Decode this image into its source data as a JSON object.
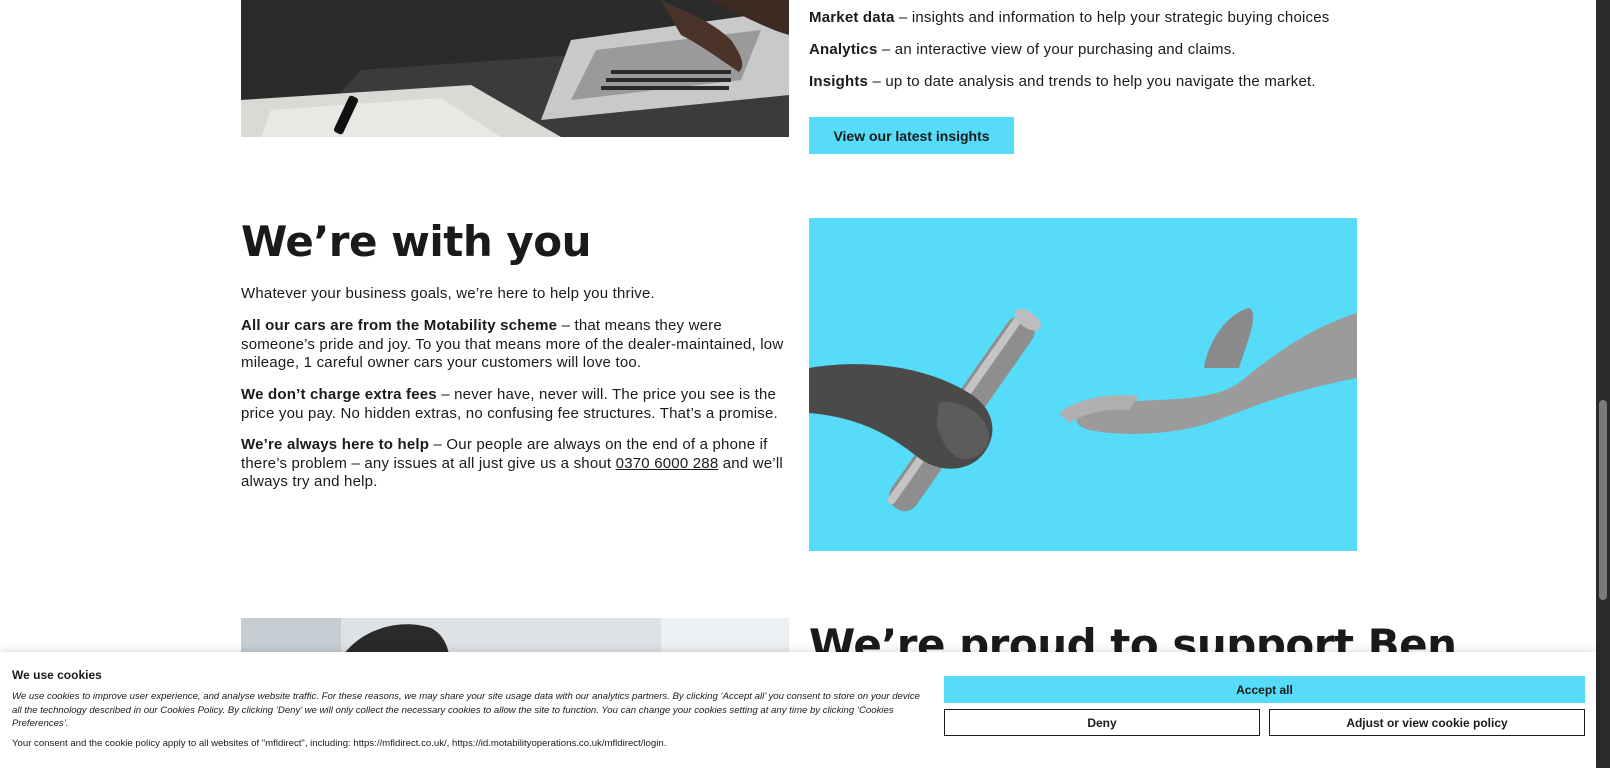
{
  "insights": {
    "items": [
      {
        "bold": "Market data",
        "text": " – insights and information to help your strategic buying choices"
      },
      {
        "bold": "Analytics",
        "text": " – an interactive view of your purchasing and claims."
      },
      {
        "bold": "Insights",
        "text": " – up to date analysis and trends to help you navigate the market."
      }
    ],
    "button_label": "View our latest insights"
  },
  "with_you": {
    "heading": "We’re with you",
    "intro": "Whatever your business goals, we’re here to help you thrive.",
    "p1_bold": "All our cars are from the Motability scheme",
    "p1_text": " – that means they were someone’s pride and joy. To you that means more of the dealer-maintained, low mileage, 1 careful owner cars your customers will love too.",
    "p2_bold": "We don’t charge extra fees",
    "p2_text": " – never have, never will. The price you see is the price you pay. No hidden extras, no confusing fee structures. That’s a promise.",
    "p3_bold": "We’re always here to help",
    "p3_text": " – Our people are always on the end of a phone if there’s problem – any issues at all just give us a shout",
    "p3_phone": "0370 6000 288",
    "p3_after": " and we’ll always try and help."
  },
  "support": {
    "heading": "We’re proud to support Ben"
  },
  "cookie": {
    "title": "We use cookies",
    "text": "We use cookies to improve user experience, and analyse website traffic. For these reasons, we may share your site usage data with our analytics partners. By clicking ‘Accept all’ you consent to store on your device all the technology described in our Cookies Policy. By clicking ‘Deny’ we will only collect the necessary cookies to allow the site to function. You can change your cookies setting at any time by clicking ‘Cookies Preferences’.",
    "consent": "Your consent and the cookie policy apply to all websites of \"mfldirect\", including: https://mfldirect.co.uk/, https://id.motabilityoperations.co.uk/mfldirect/login.",
    "accept_label": "Accept all",
    "deny_label": "Deny",
    "adjust_label": "Adjust or view cookie policy"
  },
  "colors": {
    "accent": "#56dcf8",
    "text": "#1a1a1a"
  }
}
